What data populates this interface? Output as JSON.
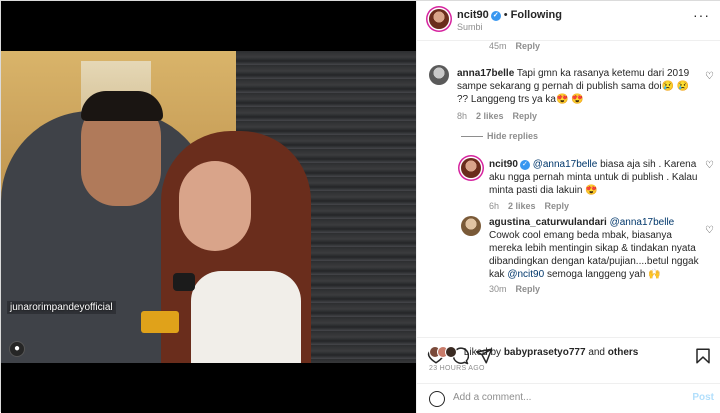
{
  "post": {
    "photo_tag": "junarorimpandeyofficial",
    "header": {
      "username": "ncit90",
      "follow_state": "Following",
      "location": "Sumbi",
      "more": "···"
    }
  },
  "comments": [
    {
      "id": "top",
      "meta_time": "45m",
      "meta_reply": "Reply"
    },
    {
      "id": "anna",
      "username": "anna17belle",
      "text": "Tapi gmn ka rasanya ketemu dari 2019 sampe sekarang g pernah di publish sama doi😢 😢 ?? Langgeng trs ya ka😍 😍",
      "time": "8h",
      "likes": "2 likes",
      "reply": "Reply",
      "hide_replies": "Hide replies"
    },
    {
      "id": "ncit",
      "username": "ncit90",
      "mention": "@anna17belle",
      "text": " biasa aja sih . Karena aku ngga pernah minta untuk di publish . Kalau minta pasti dia lakuin 😍",
      "time": "6h",
      "likes": "2 likes",
      "reply": "Reply"
    },
    {
      "id": "agustina",
      "username": "agustina_caturwulandari",
      "mention": "@anna17belle",
      "text_before": " Cowok cool emang beda mbak, biasanya mereka lebih mentingin sikap & tindakan nyata dibandingkan dengan kata/pujian....betul nggak kak ",
      "mention2": "@ncit90",
      "text_after": " semoga langgeng yah 🙌",
      "time": "30m",
      "reply": "Reply"
    }
  ],
  "likes": {
    "prefix": "Liked by",
    "user": "babyprasetyo777",
    "suffix": "and",
    "others": "others"
  },
  "timestamp": "23 HOURS AGO",
  "add_comment": {
    "placeholder": "Add a comment...",
    "post_label": "Post"
  },
  "colors": {
    "link": "#00376b",
    "verified": "#3897f0",
    "post_disabled": "#b2dffc",
    "muted": "#8e8e8e"
  }
}
